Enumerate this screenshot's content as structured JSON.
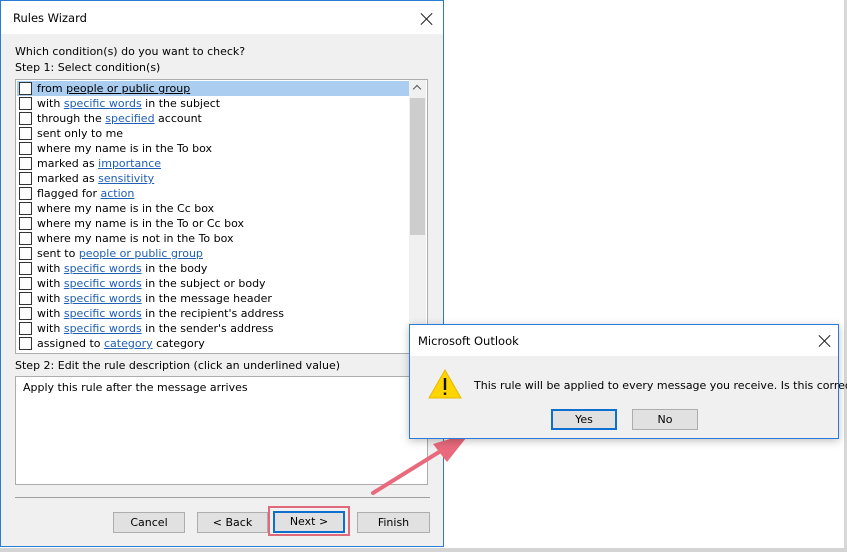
{
  "wizard": {
    "title": "Rules Wizard",
    "question": "Which condition(s) do you want to check?",
    "step1_label": "Step 1: Select condition(s)",
    "conditions": [
      {
        "pre": "from ",
        "link": "people or public group",
        "post": "",
        "checked": false,
        "selected": true
      },
      {
        "pre": "with ",
        "link": "specific words",
        "post": " in the subject",
        "checked": false,
        "selected": false
      },
      {
        "pre": "through the ",
        "link": "specified",
        "post": " account",
        "checked": false,
        "selected": false
      },
      {
        "pre": "sent only to me",
        "link": "",
        "post": "",
        "checked": false,
        "selected": false
      },
      {
        "pre": "where my name is in the To box",
        "link": "",
        "post": "",
        "checked": false,
        "selected": false
      },
      {
        "pre": "marked as ",
        "link": "importance",
        "post": "",
        "checked": false,
        "selected": false
      },
      {
        "pre": "marked as ",
        "link": "sensitivity",
        "post": "",
        "checked": false,
        "selected": false
      },
      {
        "pre": "flagged for ",
        "link": "action",
        "post": "",
        "checked": false,
        "selected": false
      },
      {
        "pre": "where my name is in the Cc box",
        "link": "",
        "post": "",
        "checked": false,
        "selected": false
      },
      {
        "pre": "where my name is in the To or Cc box",
        "link": "",
        "post": "",
        "checked": false,
        "selected": false
      },
      {
        "pre": "where my name is not in the To box",
        "link": "",
        "post": "",
        "checked": false,
        "selected": false
      },
      {
        "pre": "sent to ",
        "link": "people or public group",
        "post": "",
        "checked": false,
        "selected": false
      },
      {
        "pre": "with ",
        "link": "specific words",
        "post": " in the body",
        "checked": false,
        "selected": false
      },
      {
        "pre": "with ",
        "link": "specific words",
        "post": " in the subject or body",
        "checked": false,
        "selected": false
      },
      {
        "pre": "with ",
        "link": "specific words",
        "post": " in the message header",
        "checked": false,
        "selected": false
      },
      {
        "pre": "with ",
        "link": "specific words",
        "post": " in the recipient's address",
        "checked": false,
        "selected": false
      },
      {
        "pre": "with ",
        "link": "specific words",
        "post": " in the sender's address",
        "checked": false,
        "selected": false
      },
      {
        "pre": "assigned to ",
        "link": "category",
        "post": " category",
        "checked": false,
        "selected": false
      }
    ],
    "step2_label": "Step 2: Edit the rule description (click an underlined value)",
    "description": "Apply this rule after the message arrives",
    "buttons": {
      "cancel": "Cancel",
      "back": "< Back",
      "next": "Next >",
      "finish": "Finish"
    }
  },
  "msgbox": {
    "title": "Microsoft Outlook",
    "message": "This rule will be applied to every message you receive. Is this correct?",
    "icon": "warning-icon",
    "buttons": {
      "yes": "Yes",
      "no": "No"
    }
  },
  "colors": {
    "accent": "#2b7bd6",
    "link": "#1f5fb4",
    "selection": "#aacdf0",
    "annotation": "#e06a7a"
  }
}
